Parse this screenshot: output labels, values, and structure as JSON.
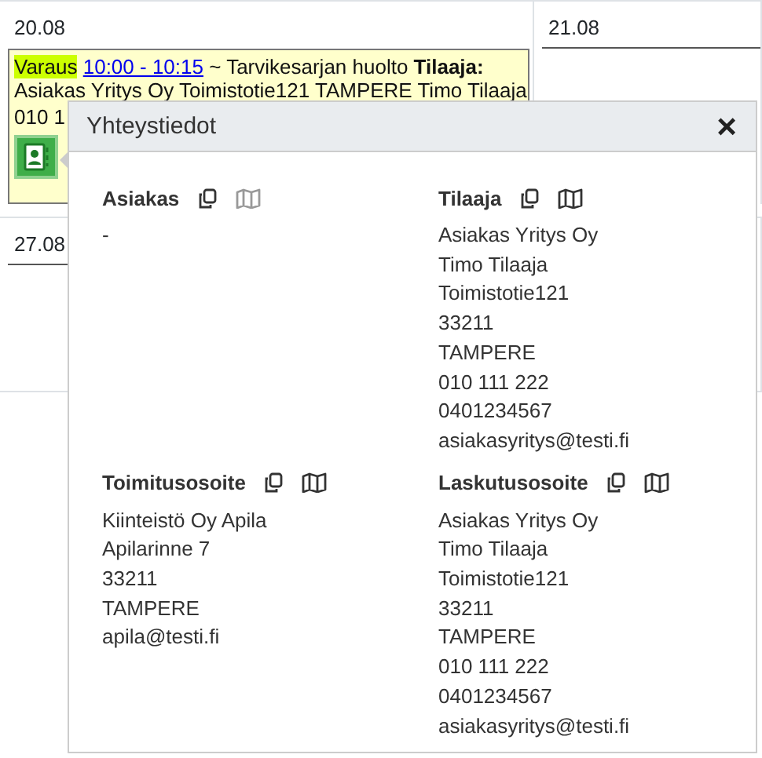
{
  "calendar": {
    "days": [
      {
        "date": "20.08"
      },
      {
        "date": "21.08"
      },
      {
        "date": "27.08"
      }
    ],
    "event": {
      "type_label": "Varaus",
      "time_link": "10:00 - 10:15",
      "line_1_rest": " ~ Tarvikesarjan huolto **Tilaaja:**",
      "line_2": "Asiakas Yritys Oy Toimistotie121 TAMPERE Timo Tilaaja",
      "line_3": "010 1"
    }
  },
  "popup": {
    "title": "Yhteystiedot",
    "close": "×",
    "sections": [
      {
        "title": "Asiakas",
        "map_disabled": true,
        "lines": [
          "-"
        ]
      },
      {
        "title": "Tilaaja",
        "map_disabled": false,
        "lines": [
          "Asiakas Yritys Oy",
          "Timo Tilaaja",
          "Toimistotie121",
          "33211",
          "TAMPERE",
          "010 111 222",
          "0401234567",
          "asiakasyritys@testi.fi"
        ]
      },
      {
        "title": "Toimitusosoite",
        "map_disabled": false,
        "lines": [
          "Kiinteistö Oy Apila",
          "Apilarinne 7",
          "33211",
          "TAMPERE",
          "apila@testi.fi"
        ]
      },
      {
        "title": "Laskutusosoite",
        "map_disabled": false,
        "lines": [
          "Asiakas Yritys Oy",
          "Timo Tilaaja",
          "Toimistotie121",
          "33211",
          "TAMPERE",
          "010 111 222",
          "0401234567",
          "asiakasyritys@testi.fi"
        ]
      }
    ]
  }
}
